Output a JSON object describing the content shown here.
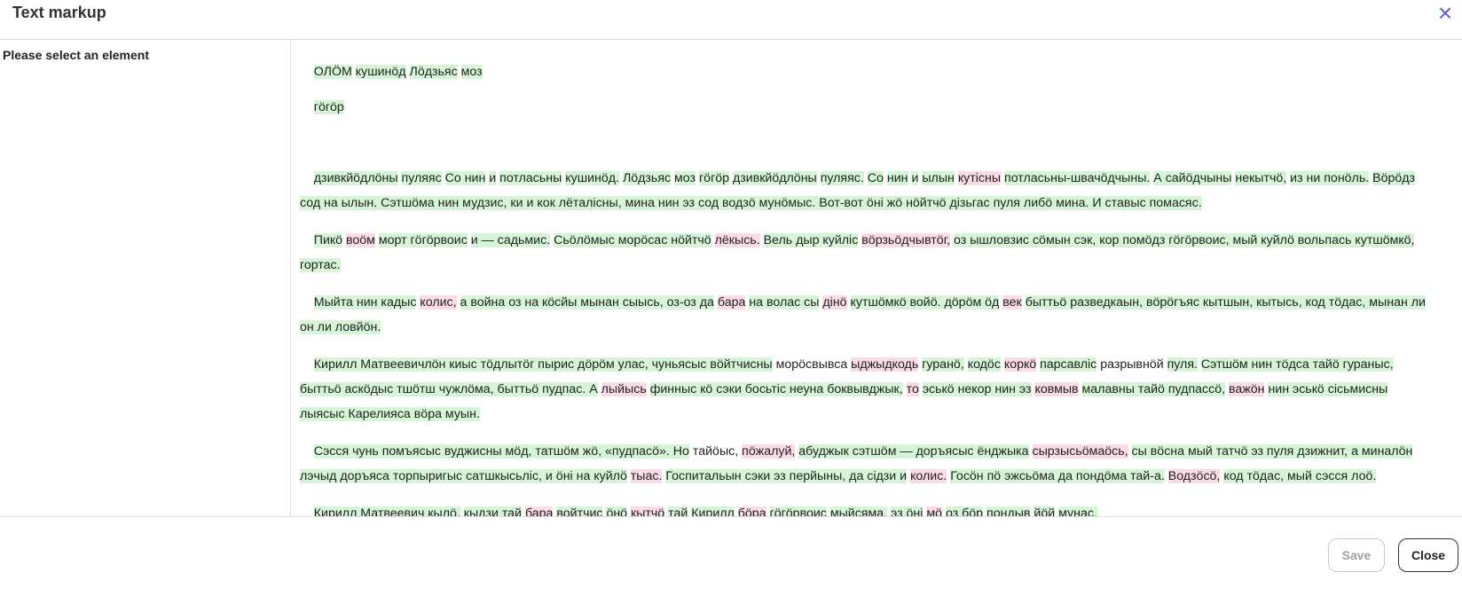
{
  "dialog": {
    "title": "Text markup",
    "close_icon": "close-icon"
  },
  "sidebar": {
    "label": "Please select an element"
  },
  "text": {
    "l1": [
      "ОЛӦМ",
      "кушинӧд",
      "Лӧдзьяс",
      "моз"
    ],
    "l2": [
      "гӧгӧр"
    ],
    "l3": [
      "дзивкйӧдлӧны",
      "пуляяс",
      "Со нин",
      "и",
      "потласьны",
      "кушинӧд.",
      "Лӧдзьяс",
      "моз",
      "гӧгӧр",
      "дзивкйӧдлӧны",
      "пуляяс.",
      "Со",
      "нин",
      "и",
      "ылын",
      "кутісны",
      "потласьны-швачӧдчыны.",
      "А сайӧдчыны",
      "некытчӧ,",
      "из ни понӧль.",
      "Вӧрӧдз"
    ],
    "l4": "сод на ылын. Сэтшӧма нин мудзис, ки и кок лёталісны, мина нин эз сод водзӧ мунӧмыс. Вот-вот ӧні жӧ нӧйтчӧ дізьгас пуля либӧ мина. И ставыс помасяс.",
    "l5": [
      "Пикӧ",
      "воӧм",
      "морт гӧгӧрвоис",
      "и — садьмис.",
      "Сьӧлӧмыс морӧсас нӧйтчӧ",
      "лёкысь.",
      "Вель дыр куйліс",
      "вӧрзьӧдчывтӧг,",
      "оз ышловзис сӧмын сэк, кор помӧдз гӧгӧрвоис, мый куйлӧ вольпась кутшӧмкӧ,"
    ],
    "l6": "гортас.",
    "l7": [
      "Мыйта нин кадыс",
      "колис,",
      "а война оз на кӧсйы мынан сыысь, оз-оз да",
      "бара",
      "на волас сы",
      "дінӧ",
      "кутшӧмкӧ войӧ. дӧрӧм ӧд",
      "век",
      "быттьӧ разведкаын, вӧрӧгъяс кытшын, кытысь, код тӧдас, мынан ли"
    ],
    "l8": "он ли ловйӧн.",
    "l9": [
      "Кирилл Матвеевичлӧн киыс тӧдлытӧг пырис дӧрӧм улас, чуньясыс вӧйтчисны",
      "морӧсвывса",
      "ыджыдкодь",
      "гуранӧ,",
      "кодӧс",
      "коркӧ",
      "парсавліс",
      "разрывнӧй",
      "пуля.",
      "Сэтшӧм нин тӧдса тайӧ гураныс,"
    ],
    "l10": [
      "быттьӧ аскӧдыс тшӧтш чужлӧма, быттьӧ пудпас. А",
      "лыйысь",
      "финныс кӧ сэки босьтіс неуна боквывджык,",
      "то",
      "эськӧ некор нин эз",
      "ковмыв",
      "малавны тайӧ пудпассӧ,",
      "важӧн",
      "нин эськӧ сісьмисны"
    ],
    "l11": "лыясыс Карелияса вӧра муын.",
    "l12": [
      "Сэсся чунь помъясыс вуджисны мӧд, татшӧм жӧ, «пудпасӧ». Но",
      "тайӧыс,",
      "пӧжалуй,",
      "абуджык сэтшӧм — доръясыс ёнджыка",
      "сырзысьӧмаӧсь,",
      "сы вӧсна мый татчӧ эз пуля дзижнит, а миналӧн"
    ],
    "l13": [
      "лэчыд доръяса торпыригыс сатшкысьліс, и ӧні на куйлӧ",
      "тыас.",
      "Госпитальын сэки эз перйыны, да сідзи и",
      "колис.",
      "Госӧн пӧ эжсьӧма да пондӧма тай-а.",
      "Водзӧсӧ,",
      "код тӧдас, мый сэсся лоӧ."
    ],
    "l14": [
      "Кирилл Матвеевич кылӧ,",
      "кыдзи тай",
      "бара",
      "войтчис",
      "ӧнӧ",
      "кытчӧ",
      "тай",
      "Кирилл",
      "бӧра",
      "гӧгӧрвоис",
      "мыйсяма,",
      "эз ӧні",
      "мӧ",
      "оз бӧр",
      "пондыв",
      "йӧй",
      "мунас."
    ]
  },
  "footer": {
    "save_label": "Save",
    "close_label": "Close"
  }
}
